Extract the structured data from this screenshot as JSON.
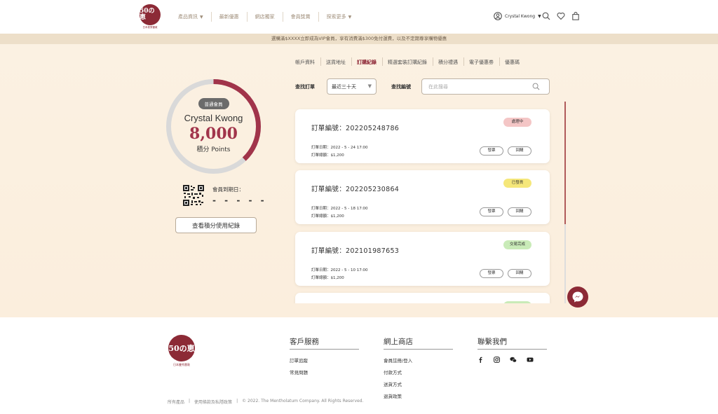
{
  "brand": {
    "logo_text": "50の恵",
    "logo_sub": "日本曼秀雷敦"
  },
  "nav": {
    "items": [
      {
        "label": "產品資訊",
        "caret": "▼"
      },
      {
        "label": "最新優惠"
      },
      {
        "label": "網店獨家"
      },
      {
        "label": "會員獎賞"
      },
      {
        "label": "探索更多",
        "caret": "▼"
      }
    ],
    "user_name": "Crystal Kwong",
    "user_caret": "▼"
  },
  "promo": "選購滿$XXXX立即成為VIP會員，享有消費滿$300免付運費，以及不定期尊享購物優惠",
  "profile": {
    "member_level": "普通會員",
    "name": "Crystal Kwong",
    "points": "8,000",
    "points_label": "積分 Points",
    "points_progress": 0.38,
    "expiry_label": "會員到期日：",
    "expiry_value": "- - - - -",
    "history_button": "查看積分使用紀錄"
  },
  "tabs": [
    "帳戶資料",
    "送貨地址",
    "訂購紀錄",
    "精選套裝訂購紀錄",
    "積分禮遇",
    "電子優惠劵",
    "優惠碼"
  ],
  "active_tab": 2,
  "filters": {
    "order_label": "查找訂單",
    "order_value": "最近三十天",
    "search_label": "查找編號",
    "search_placeholder": "在此搜尋"
  },
  "orders": [
    {
      "number": "訂單編號：202205248786",
      "status": "處理中",
      "status_color": "#f4c6c6",
      "date": "訂單日期：2022 - 5 - 24  17:00",
      "total": "訂單總額：$1,200",
      "btn1": "發票",
      "btn2": "回購"
    },
    {
      "number": "訂單編號：202205230864",
      "status": "已發貨",
      "status_color": "#f5e77a",
      "date": "訂單日期：2022 - 5 - 18  17:00",
      "total": "訂單總額：$1,200",
      "btn1": "發票",
      "btn2": "回購"
    },
    {
      "number": "訂單編號：202101987653",
      "status": "交易完成",
      "status_color": "#c9ebb8",
      "date": "訂單日期：2022 - 5 - 10  17:00",
      "total": "訂單總額：$1,200",
      "btn1": "發票",
      "btn2": "回購"
    }
  ],
  "footer": {
    "cols": [
      {
        "title": "客戶服務",
        "links": [
          "訂單追蹤",
          "常見問題"
        ]
      },
      {
        "title": "網上商店",
        "links": [
          "會員註冊/登入",
          "付款方式",
          "送貨方式",
          "退貨政策"
        ]
      },
      {
        "title": "聯繫我們",
        "social": [
          "facebook-icon",
          "instagram-icon",
          "wechat-icon",
          "youtube-icon"
        ]
      }
    ],
    "bottom": [
      "所有產品",
      "|",
      "使用條款及私隱政策",
      "|",
      "© 2022. The Mentholatum Company. All Rights Reserved."
    ]
  },
  "colors": {
    "accent": "#a1344a",
    "brand": "#8c2a36",
    "banner": "#eddfc9",
    "background": "#fbf1e2"
  }
}
